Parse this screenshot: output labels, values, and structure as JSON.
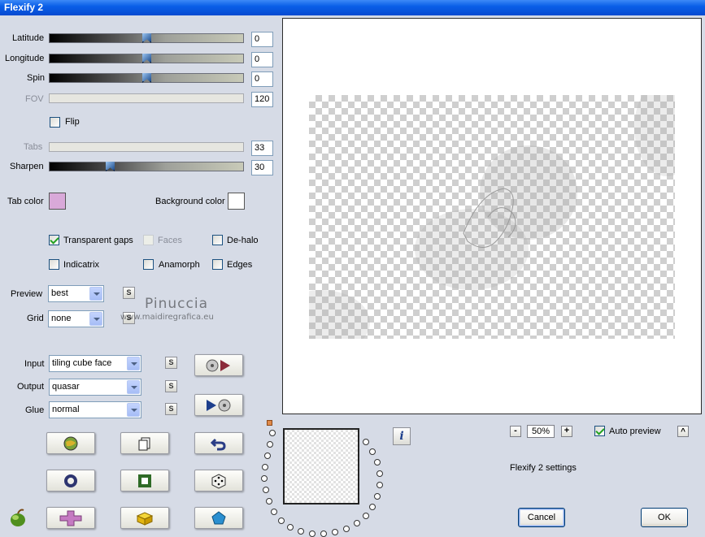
{
  "window": {
    "title": "Flexify 2"
  },
  "sliders": {
    "latitude": {
      "label": "Latitude",
      "value": "0",
      "fraction": 0.5
    },
    "longitude": {
      "label": "Longitude",
      "value": "0",
      "fraction": 0.5
    },
    "spin": {
      "label": "Spin",
      "value": "0",
      "fraction": 0.5
    },
    "fov": {
      "label": "FOV",
      "value": "120",
      "fraction": 0.0
    },
    "tabs": {
      "label": "Tabs",
      "value": "33",
      "fraction": 0.0
    },
    "sharpen": {
      "label": "Sharpen",
      "value": "30",
      "fraction": 0.3
    }
  },
  "flip": {
    "label": "Flip",
    "checked": false
  },
  "colors": {
    "tab_color_label": "Tab color",
    "tab_color": "#d9a9d9",
    "background_color_label": "Background color",
    "background_color": "#ffffff"
  },
  "options": {
    "transparent_gaps": {
      "label": "Transparent gaps",
      "checked": true
    },
    "faces": {
      "label": "Faces",
      "checked": false
    },
    "de_halo": {
      "label": "De-halo",
      "checked": false
    },
    "indicatrix": {
      "label": "Indicatrix",
      "checked": false
    },
    "anamorph": {
      "label": "Anamorph",
      "checked": false
    },
    "edges": {
      "label": "Edges",
      "checked": false
    }
  },
  "preview": {
    "label": "Preview",
    "value": "best"
  },
  "grid": {
    "label": "Grid",
    "value": "none"
  },
  "watermark": {
    "name": "Pinuccia",
    "site": "www.maidiregrafica.eu"
  },
  "input": {
    "label": "Input",
    "value": "tiling cube face"
  },
  "output": {
    "label": "Output",
    "value": "quasar"
  },
  "glue": {
    "label": "Glue",
    "value": "normal"
  },
  "s_button": "S",
  "zoom": {
    "minus": "-",
    "value": "50%",
    "plus": "+"
  },
  "auto_preview": {
    "label": "Auto preview",
    "checked": true
  },
  "caret_button": "^",
  "settings_label": "Flexify 2 settings",
  "info_button": "i",
  "buttons": {
    "cancel": "Cancel",
    "ok": "OK"
  }
}
